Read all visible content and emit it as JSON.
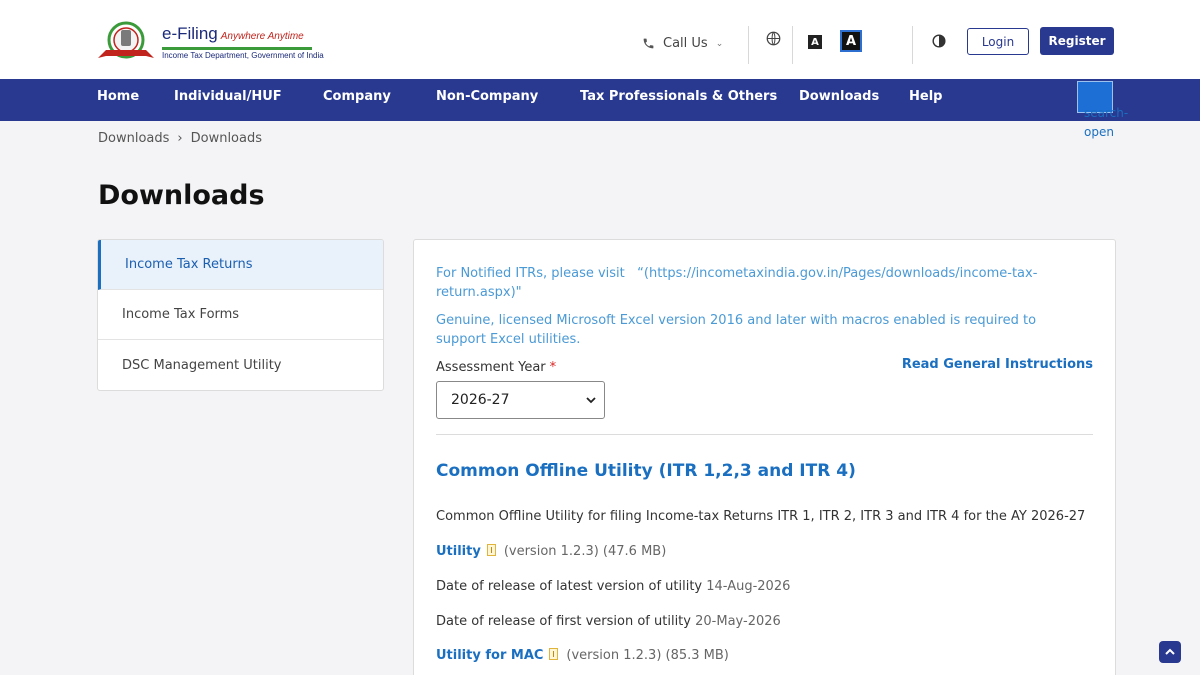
{
  "header": {
    "logo": {
      "title": "e-Filing",
      "tagline": "Anywhere Anytime",
      "subtitle": "Income Tax Department, Government of India",
      "emblem_text": "INCOME TAX DEPARTMENT"
    },
    "call_us_label": "Call Us",
    "font_small_label": "A",
    "font_large_label": "A",
    "login_label": "Login",
    "register_label": "Register"
  },
  "nav": {
    "items": [
      {
        "label": "Home"
      },
      {
        "label": "Individual/HUF"
      },
      {
        "label": "Company"
      },
      {
        "label": "Non-Company"
      },
      {
        "label": "Tax Professionals & Others"
      },
      {
        "label": "Downloads"
      },
      {
        "label": "Help"
      }
    ],
    "search_alt": "search-open"
  },
  "breadcrumb": {
    "items": [
      "Downloads",
      "Downloads"
    ],
    "separator": "›"
  },
  "page_title": "Downloads",
  "sidebar": {
    "items": [
      {
        "label": "Income Tax Returns",
        "active": true
      },
      {
        "label": "Income Tax Forms",
        "active": false
      },
      {
        "label": "DSC Management Utility",
        "active": false
      }
    ]
  },
  "content": {
    "notice_itr": "For Notified ITRs, please visit   “(https://incometaxindia.gov.in/Pages/downloads/income-tax-return.aspx)\"",
    "notice_excel": "Genuine, licensed Microsoft Excel version 2016 and later with macros enabled is required to support Excel utilities.",
    "assessment_year_label": "Assessment Year",
    "required_mark": "*",
    "assessment_year_value": "2026-27",
    "read_instructions": "Read General Instructions",
    "section_title": "Common Offline Utility (ITR 1,2,3 and ITR 4)",
    "description": "Common Offline Utility for filing Income-tax Returns ITR 1, ITR 2, ITR 3 and ITR 4 for the AY 2026-27",
    "utility_link": "Utility",
    "utility_meta": "(version 1.2.3) (47.6 MB)",
    "latest_release_label": "Date of release of latest version of utility",
    "latest_release_date": "14-Aug-2026",
    "first_release_label": "Date of release of first version of utility",
    "first_release_date": "20-May-2026",
    "mac_link": "Utility for MAC",
    "mac_meta": "(version 1.2.3) (85.3 MB)"
  },
  "colors": {
    "brand_navy": "#2a3990",
    "link_blue": "#1a6fc0",
    "notice_blue": "#4a9ad6",
    "page_bg": "#f4f4f6"
  }
}
